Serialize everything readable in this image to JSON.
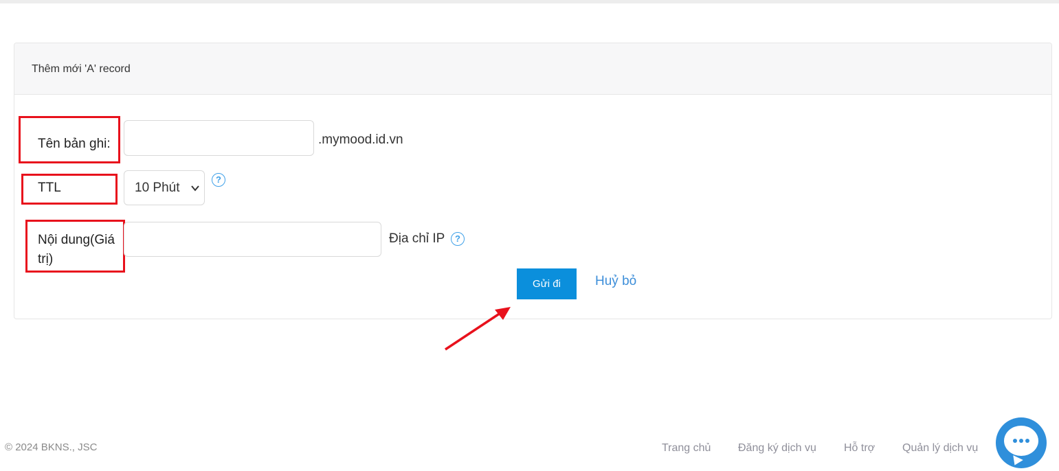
{
  "panel": {
    "title": "Thêm mới 'A' record"
  },
  "form": {
    "record_name": {
      "label": "Tên bản ghi:",
      "value": "",
      "suffix": ".mymood.id.vn"
    },
    "ttl": {
      "label": "TTL",
      "selected": "10 Phút"
    },
    "content": {
      "label_line1": "Nội dung(Giá",
      "label_line2": "trị)",
      "value": "",
      "hint": "Địa chỉ IP"
    },
    "help_glyph": "?"
  },
  "actions": {
    "submit_label": "Gửi đi",
    "cancel_label": "Huỷ bỏ"
  },
  "footer": {
    "copyright": "© 2024 BKNS., JSC",
    "links": [
      "Trang chủ",
      "Đăng ký dịch vụ",
      "Hỗ trợ",
      "Quản lý dịch vụ"
    ]
  },
  "colors": {
    "accent": "#0b8fdc",
    "annotation": "#e8111c",
    "link": "#3d8ed9"
  },
  "icons": {
    "help": "question-circle-icon",
    "chat": "chat-bubble-icon",
    "select": "chevron-down-icon"
  }
}
